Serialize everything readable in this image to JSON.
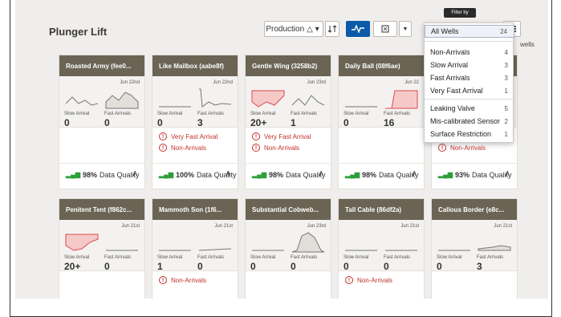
{
  "title": "Plunger Lift",
  "toolbar": {
    "production_label": "Production",
    "production_icon": "△ ▾",
    "sort_icon": "sort-icon",
    "list_icon": "list-icon"
  },
  "wells_tag": "wells",
  "filter": {
    "tooltip": "Filter by",
    "items": [
      {
        "label": "All Wells",
        "count": "24"
      },
      {
        "label": "Non-Arrivals",
        "count": "4"
      },
      {
        "label": "Slow Arrival",
        "count": "3"
      },
      {
        "label": "Fast Arrivals",
        "count": "3"
      },
      {
        "label": "Very Fast Arrival",
        "count": "1"
      },
      {
        "label": "Leaking Valve",
        "count": "5"
      },
      {
        "label": "Mis-calibrated Sensor",
        "count": "2"
      },
      {
        "label": "Surface Restriction",
        "count": "1"
      }
    ]
  },
  "card_labels": {
    "slow": "Slow Arrival",
    "fast": "Fast Arrivals",
    "dq_label": "Data Quality"
  },
  "cards": [
    {
      "name": "Roasted Army (fee0...",
      "date": "Jun 22nd",
      "slow": "0",
      "fast": "0",
      "alerts": [],
      "dq": "98%"
    },
    {
      "name": "Like Mailbox (aabe8f)",
      "date": "Jun 22nd",
      "slow": "0",
      "fast": "3",
      "alerts": [
        "Very Fast Arrival",
        "Non-Arrivals"
      ],
      "dq": "100%"
    },
    {
      "name": "Gentle Wing (3258b2)",
      "date": "Jun 23rd",
      "slow": "20+",
      "fast": "1",
      "alerts": [
        "Very Fast Arrival",
        "Non-Arrivals"
      ],
      "dq": "98%"
    },
    {
      "name": "Daily Ball (08f6ae)",
      "date": "Jun 22",
      "slow": "0",
      "fast": "16",
      "alerts": [],
      "dq": "98%"
    },
    {
      "name": "",
      "date": "3rd",
      "slow": "",
      "fast": "",
      "alerts": [
        "Leaking Valve",
        "Non-Arrivals"
      ],
      "dq": "93%"
    },
    {
      "name": "Penitent Tent (f862c...",
      "date": "Jun 21st",
      "slow": "20+",
      "fast": "0",
      "alerts": [],
      "dq": ""
    },
    {
      "name": "Mammoth Son (1f6...",
      "date": "Jun 21st",
      "slow": "1",
      "fast": "0",
      "alerts": [
        "Non-Arrivals"
      ],
      "dq": ""
    },
    {
      "name": "Substantial Cobweb...",
      "date": "Jun 23rd",
      "slow": "0",
      "fast": "0",
      "alerts": [],
      "dq": ""
    },
    {
      "name": "Tall Cable (86df2a)",
      "date": "Jun 21st",
      "slow": "0",
      "fast": "0",
      "alerts": [
        "Non-Arrivals"
      ],
      "dq": ""
    },
    {
      "name": "Callous Border (e8c...",
      "date": "Jun 21st",
      "slow": "0",
      "fast": "3",
      "alerts": [],
      "dq": ""
    }
  ]
}
